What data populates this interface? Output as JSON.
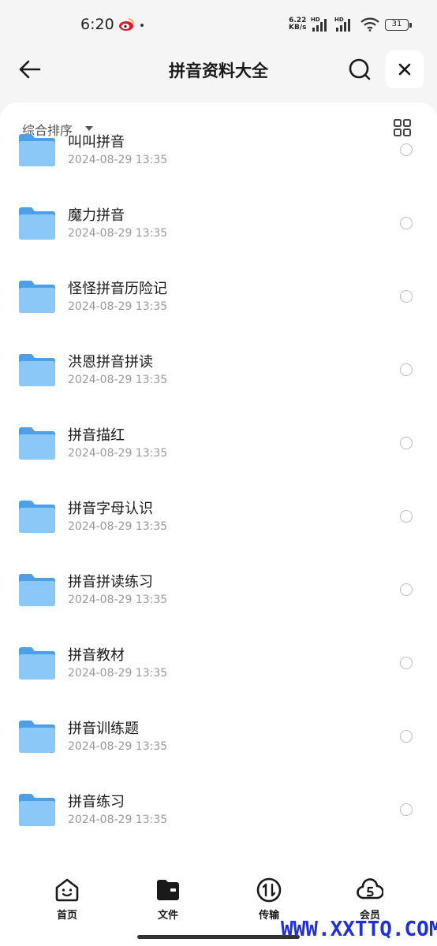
{
  "status_bar": {
    "time": "6:20",
    "net_speed_value": "6.22",
    "net_speed_unit": "KB/s",
    "hd1": "HD",
    "hd2": "HD",
    "battery": "31"
  },
  "header": {
    "title": "拼音资料大全"
  },
  "sort_bar": {
    "sort_label": "综合排序"
  },
  "files": [
    {
      "name": "叫叫拼音",
      "date": "2024-08-29 13:35"
    },
    {
      "name": "魔力拼音",
      "date": "2024-08-29 13:35"
    },
    {
      "name": "怪怪拼音历险记",
      "date": "2024-08-29 13:35"
    },
    {
      "name": "洪恩拼音拼读",
      "date": "2024-08-29 13:35"
    },
    {
      "name": "拼音描红",
      "date": "2024-08-29 13:35"
    },
    {
      "name": "拼音字母认识",
      "date": "2024-08-29 13:35"
    },
    {
      "name": "拼音拼读练习",
      "date": "2024-08-29 13:35"
    },
    {
      "name": "拼音教材",
      "date": "2024-08-29 13:35"
    },
    {
      "name": "拼音训练题",
      "date": "2024-08-29 13:35"
    },
    {
      "name": "拼音练习",
      "date": "2024-08-29 13:35"
    }
  ],
  "bottom_nav": {
    "items": [
      {
        "label": "首页",
        "icon": "home-face-icon"
      },
      {
        "label": "文件",
        "icon": "folder-filled-icon"
      },
      {
        "label": "传输",
        "icon": "transfer-icon"
      },
      {
        "label": "会员",
        "icon": "vip-cloud-icon"
      }
    ]
  },
  "watermark": "WWW.XXTTQ.COM",
  "colors": {
    "folder": "#6fb6f2",
    "watermark": "#1d2fe0",
    "background": "#f5f5f5"
  }
}
